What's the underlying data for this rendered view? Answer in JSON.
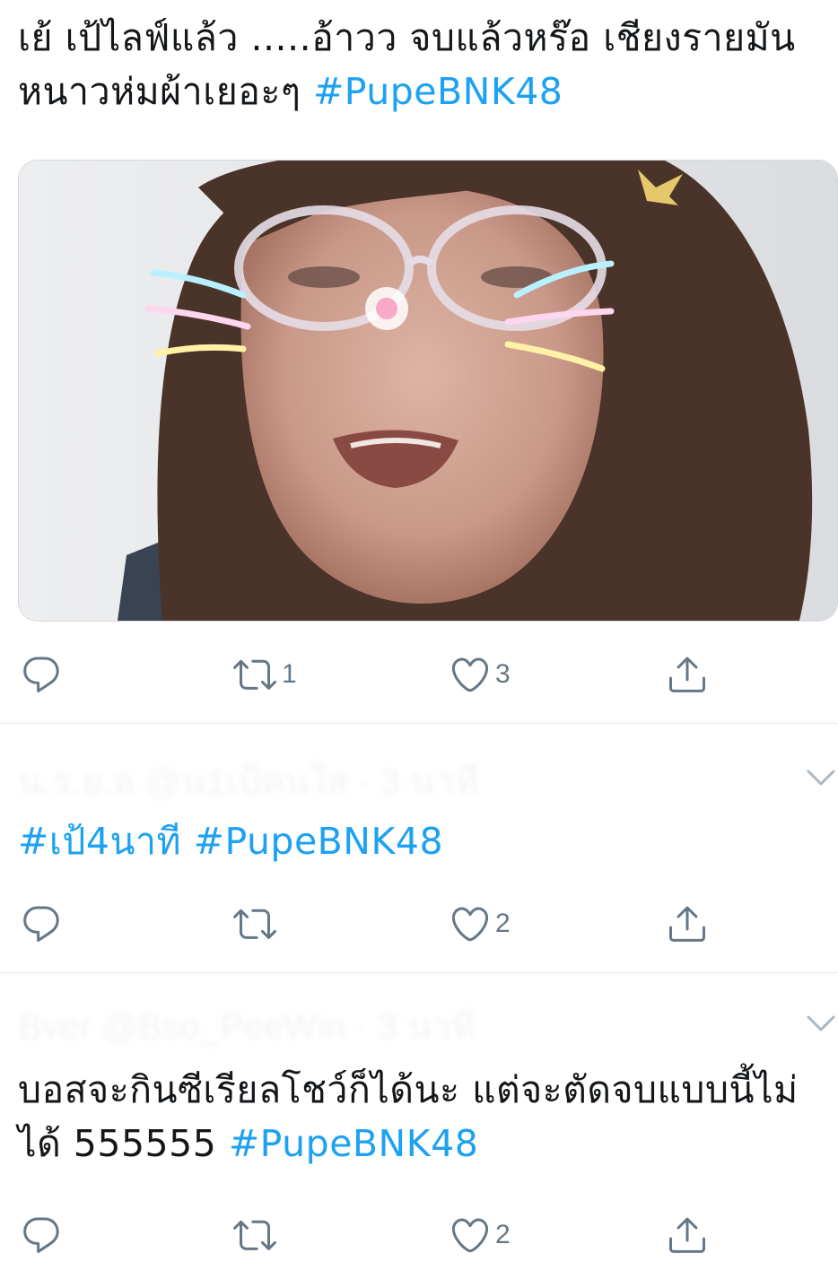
{
  "tweets": [
    {
      "text_plain": "เย้ เป้ไลฟ์แล้ว .....อ้าวว จบแล้วหร๊อ เชียงรายมันหนาวห่มผ้าเยอะๆ ",
      "text_tag": "#PupeBNK48",
      "retweets": "1",
      "likes": "3"
    },
    {
      "header": "น.ร.ย.ล @น1เป้คนใส · 3 นาที",
      "text_plain": "",
      "text_tag": "#เป้4นาที #PupeBNK48",
      "retweets": "",
      "likes": "2"
    },
    {
      "header": "Bver @Bso_PeeWin · 3 นาที",
      "text_plain": "บอสจะกินซีเรียลโชว์ก็ได้นะ แต่จะตัดจบแบบนี้ไม่ได้ 555555 ",
      "text_tag": "#PupeBNK48",
      "retweets": "",
      "likes": "2"
    }
  ],
  "icons": {
    "reply": "reply-icon",
    "retweet": "retweet-icon",
    "like": "heart-icon",
    "share": "share-icon",
    "chevron": "chevron-down-icon"
  },
  "colors": {
    "hashtag": "#1da1f2",
    "text": "#14171a",
    "icon": "#657786",
    "divider": "#e1e8ed"
  }
}
